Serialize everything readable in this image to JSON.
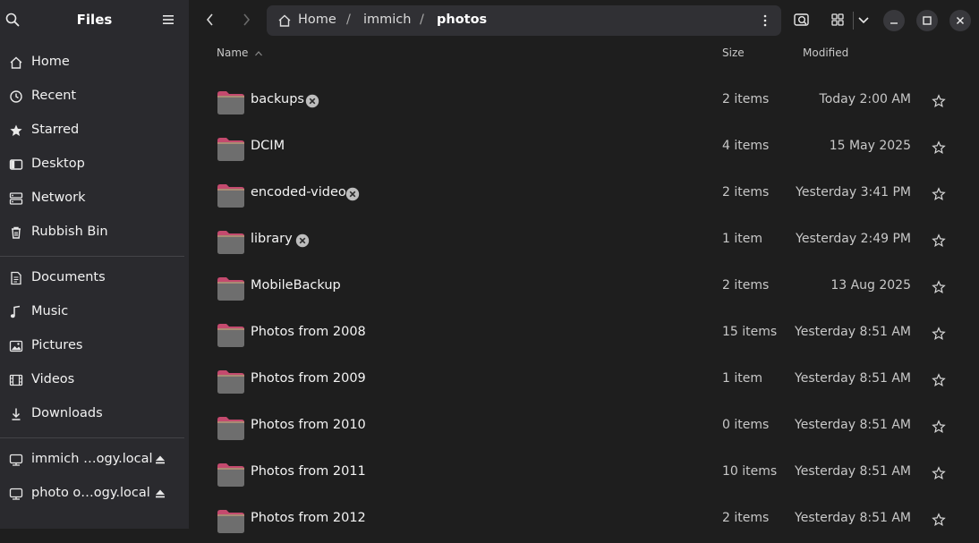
{
  "window": {
    "title": "Files"
  },
  "sidebar": {
    "title": "Files",
    "places": [
      {
        "label": "Home",
        "icon": "home-icon"
      },
      {
        "label": "Recent",
        "icon": "clock-icon"
      },
      {
        "label": "Starred",
        "icon": "star-icon"
      },
      {
        "label": "Desktop",
        "icon": "desktop-icon"
      },
      {
        "label": "Network",
        "icon": "network-icon"
      },
      {
        "label": "Rubbish Bin",
        "icon": "trash-icon"
      }
    ],
    "bookmarks": [
      {
        "label": "Documents",
        "icon": "document-icon"
      },
      {
        "label": "Music",
        "icon": "music-icon"
      },
      {
        "label": "Pictures",
        "icon": "picture-icon"
      },
      {
        "label": "Videos",
        "icon": "video-icon"
      },
      {
        "label": "Downloads",
        "icon": "download-icon"
      }
    ],
    "mounts": [
      {
        "label": "immich …ogy.local",
        "icon": "network-drive-icon"
      },
      {
        "label": "photo o…ogy.local",
        "icon": "network-drive-icon"
      }
    ]
  },
  "breadcrumb": {
    "home": "Home",
    "sep1": "/",
    "p1": "immich",
    "sep2": "/",
    "current": "photos"
  },
  "columns": {
    "name": "Name",
    "size": "Size",
    "modified": "Modified"
  },
  "files": [
    {
      "name": "backups",
      "size": "2 items",
      "modified": "Today 2:00 AM",
      "badge": true
    },
    {
      "name": "DCIM",
      "size": "4 items",
      "modified": "15 May 2025",
      "badge": false
    },
    {
      "name": "encoded-video",
      "size": "2 items",
      "modified": "Yesterday 3:41 PM",
      "badge": true
    },
    {
      "name": "library",
      "size": "1 item",
      "modified": "Yesterday 2:49 PM",
      "badge": true
    },
    {
      "name": "MobileBackup",
      "size": "2 items",
      "modified": "13 Aug 2025",
      "badge": false
    },
    {
      "name": "Photos from 2008",
      "size": "15 items",
      "modified": "Yesterday 8:51 AM",
      "badge": false
    },
    {
      "name": "Photos from 2009",
      "size": "1 item",
      "modified": "Yesterday 8:51 AM",
      "badge": false
    },
    {
      "name": "Photos from 2010",
      "size": "0 items",
      "modified": "Yesterday 8:51 AM",
      "badge": false
    },
    {
      "name": "Photos from 2011",
      "size": "10 items",
      "modified": "Yesterday 8:51 AM",
      "badge": false
    },
    {
      "name": "Photos from 2012",
      "size": "2 items",
      "modified": "Yesterday 8:51 AM",
      "badge": false
    }
  ],
  "colors": {
    "sidebar_bg": "#2a2a2e",
    "main_bg": "#1e1e1e",
    "folder_body": "#6e6e6e",
    "folder_tab": "#c44a6e"
  }
}
